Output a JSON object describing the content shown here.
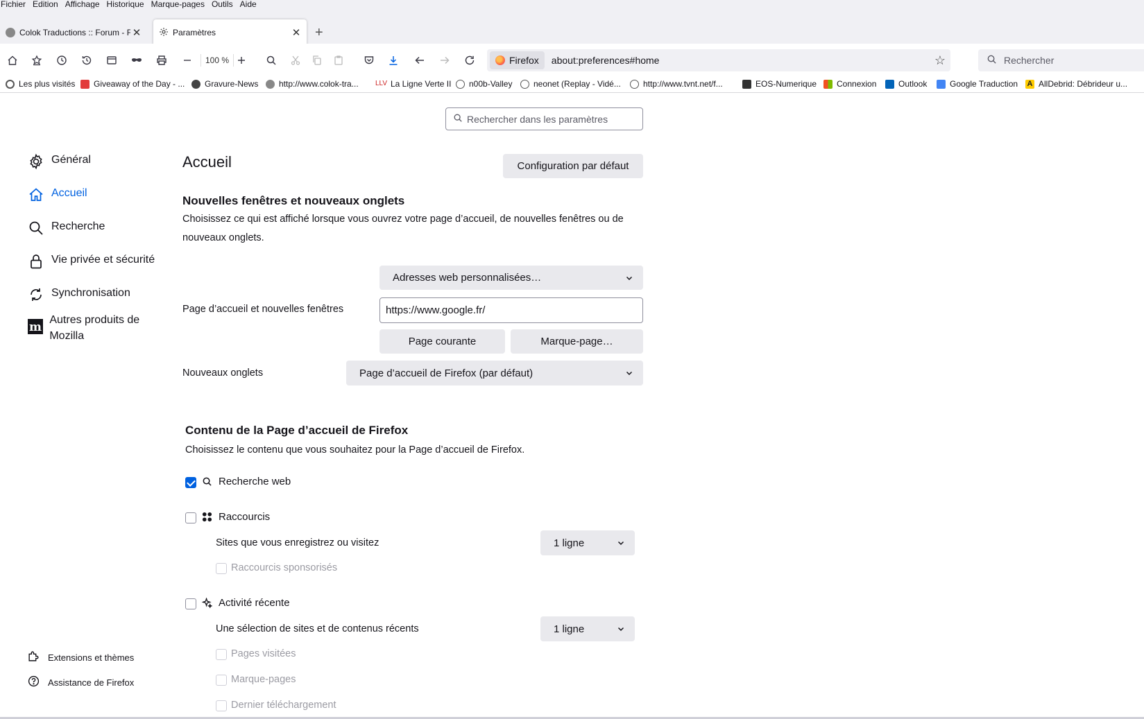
{
  "menu": [
    "Fichier",
    "Edition",
    "Affichage",
    "Historique",
    "Marque-pages",
    "Outils",
    "Aide"
  ],
  "tabs": [
    {
      "label": "Colok Traductions :: Forum - Fir"
    },
    {
      "label": "Paramètres"
    }
  ],
  "toolbar": {
    "zoom": "100 %",
    "identity": "Firefox",
    "url": "about:preferences#home",
    "search_placeholder": "Rechercher"
  },
  "bookmarks": [
    {
      "label": "Les plus visités",
      "color": "#555555"
    },
    {
      "label": "Giveaway of the Day - ...",
      "color": "#e23c3c"
    },
    {
      "label": "Gravure-News",
      "color": "#444444"
    },
    {
      "label": "http://www.colok-tra...",
      "color": "#555555"
    },
    {
      "label": "La Ligne Verte II",
      "color": "#cc2222"
    },
    {
      "label": "n00b-Valley",
      "color": "#555555"
    },
    {
      "label": "neonet (Replay - Vidé...",
      "color": "#555555"
    },
    {
      "label": "http://www.tvnt.net/f...",
      "color": "#555555"
    },
    {
      "label": "EOS-Numerique",
      "color": "#333333"
    },
    {
      "label": "Connexion",
      "color": "#f25022"
    },
    {
      "label": "Outlook",
      "color": "#0364b8"
    },
    {
      "label": "Google Traduction",
      "color": "#4285f4"
    },
    {
      "label": "AllDebrid: Débrideur u...",
      "color": "#222222"
    }
  ],
  "prefs": {
    "search_placeholder": "Rechercher dans les paramètres",
    "categories": [
      {
        "label": "Général"
      },
      {
        "label": "Accueil"
      },
      {
        "label": "Recherche"
      },
      {
        "label": "Vie privée et sécurité"
      },
      {
        "label": "Synchronisation"
      },
      {
        "label": "Autres produits de Mozilla"
      }
    ],
    "footer": {
      "extensions": "Extensions et thèmes",
      "support": "Assistance de Firefox"
    },
    "title": "Accueil",
    "restore_defaults": "Configuration par défaut",
    "section1": {
      "heading": "Nouvelles fenêtres et nouveaux onglets",
      "description": "Choisissez ce qui est affiché lorsque vous ouvrez votre page d’accueil, de nouvelles fenêtres ou de nouveaux onglets.",
      "homepage_mode": "Adresses web personnalisées…",
      "homepage_label": "Page d’accueil et nouvelles fenêtres",
      "homepage_url": "https://www.google.fr/",
      "use_current": "Page courante",
      "use_bookmark": "Marque-page…",
      "newtabs_label": "Nouveaux onglets",
      "newtabs_value": "Page d’accueil de Firefox (par défaut)"
    },
    "section2": {
      "heading": "Contenu de la Page d’accueil de Firefox",
      "description": "Choisissez le contenu que vous souhaitez pour la Page d’accueil de Firefox.",
      "web_search": {
        "label": "Recherche web",
        "checked": true
      },
      "shortcuts": {
        "label": "Raccourcis",
        "checked": false,
        "sub": "Sites que vous enregistrez ou visitez",
        "rows": "1 ligne",
        "sponsored": "Raccourcis sponsorisés"
      },
      "recent": {
        "label": "Activité récente",
        "checked": false,
        "sub": "Une sélection de sites et de contenus récents",
        "rows": "1 ligne",
        "options": [
          "Pages visitées",
          "Marque-pages",
          "Dernier téléchargement"
        ]
      }
    },
    "colors": {
      "accent": "#0061e0",
      "button_bg": "#e9e9ed"
    }
  }
}
